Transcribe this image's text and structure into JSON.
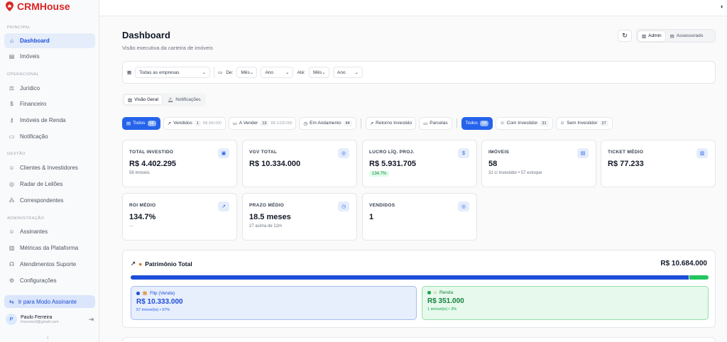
{
  "app": {
    "name": "CRMHouse"
  },
  "sidebar": {
    "sections": [
      {
        "label": "PRINCIPAL",
        "items": [
          {
            "label": "Dashboard",
            "icon": "home-icon",
            "active": true
          },
          {
            "label": "Imóveis",
            "icon": "building-icon"
          }
        ]
      },
      {
        "label": "OPERACIONAL",
        "items": [
          {
            "label": "Jurídico",
            "icon": "scale-icon"
          },
          {
            "label": "Financeiro",
            "icon": "dollar-icon"
          },
          {
            "label": "Imóveis de Renda",
            "icon": "key-icon"
          },
          {
            "label": "Notificação",
            "icon": "message-icon"
          }
        ]
      },
      {
        "label": "GESTÃO",
        "items": [
          {
            "label": "Clientes & Investidores",
            "icon": "users-icon"
          },
          {
            "label": "Radar de Leilões",
            "icon": "radar-icon"
          },
          {
            "label": "Correspondentes",
            "icon": "network-icon"
          }
        ]
      },
      {
        "label": "ADMINISTRAÇÃO",
        "items": [
          {
            "label": "Assinantes",
            "icon": "users-icon"
          },
          {
            "label": "Métricas da Plataforma",
            "icon": "bar-chart-icon"
          },
          {
            "label": "Atendimentos Suporte",
            "icon": "headset-icon"
          },
          {
            "label": "Configurações",
            "icon": "gear-icon"
          }
        ]
      }
    ],
    "mode_button": "Ir para Modo Assinante",
    "user": {
      "initial": "P",
      "name": "Paulo Ferreira",
      "email": "imoveiscf@gmail.com"
    }
  },
  "header": {
    "title": "Dashboard",
    "subtitle": "Visão executiva da carteira de imóveis",
    "roles": [
      "Admin",
      "Assessorado"
    ]
  },
  "filters": {
    "company": "Todas as empresas",
    "from_label": "De:",
    "to_label": "Até:",
    "month": "Mês",
    "year": "Ano"
  },
  "view_tabs": [
    "Visão Geral",
    "Notificações"
  ],
  "chips": {
    "group1": [
      {
        "label": "Todos",
        "count": "58",
        "active": true
      },
      {
        "label": "Vendidos",
        "count": "1",
        "amount": "R$ 350.000"
      },
      {
        "label": "A Vender",
        "count": "13",
        "amount": "R$ 3.030.065"
      },
      {
        "label": "Em Andamento",
        "count": "44"
      }
    ],
    "group2": [
      {
        "label": "Retorno Investido"
      },
      {
        "label": "Parcelas"
      }
    ],
    "group3": [
      {
        "label": "Todos",
        "count": "58",
        "active": true
      },
      {
        "label": "Com Investidor",
        "count": "31"
      },
      {
        "label": "Sem Investidor",
        "count": "27"
      }
    ]
  },
  "cards": [
    {
      "title": "TOTAL INVESTIDO",
      "value": "R$ 4.402.295",
      "sub": "58 imóveis",
      "icon": "wallet-icon"
    },
    {
      "title": "VGV TOTAL",
      "value": "R$ 10.334.000",
      "icon": "target-icon"
    },
    {
      "title": "LUCRO LÍQ. PROJ.",
      "value": "R$ 5.931.705",
      "badge": "134.7%",
      "icon": "dollar-icon"
    },
    {
      "title": "IMÓVEIS",
      "value": "58",
      "sub": "31 c/ investidor • 57 estoque",
      "icon": "building-icon"
    },
    {
      "title": "TICKET MÉDIO",
      "value": "R$ 77.233",
      "icon": "bar-chart-icon"
    },
    {
      "title": "ROI MÉDIO",
      "value": "134.7%",
      "icon": "trend-up-icon",
      "dash": true
    },
    {
      "title": "PRAZO MÉDIO",
      "value": "18.5 meses",
      "sub": "27 acima de 12m",
      "icon": "clock-icon"
    },
    {
      "title": "VENDIDOS",
      "value": "1",
      "icon": "target-icon"
    }
  ],
  "patrimonio": {
    "title": "Patrimônio Total",
    "total": "R$ 10.684.000",
    "blue_fraction": 0.967,
    "green_fraction": 0.033,
    "flip": {
      "label": "Flip (Venda)",
      "value": "R$ 10.333.000",
      "sub": "57 imóvel(is) • 97%",
      "color": "#2563eb"
    },
    "renda": {
      "label": "Renda",
      "value": "R$ 351.000",
      "sub": "1 imóvel(is) • 3%",
      "color": "#22c55e"
    }
  }
}
